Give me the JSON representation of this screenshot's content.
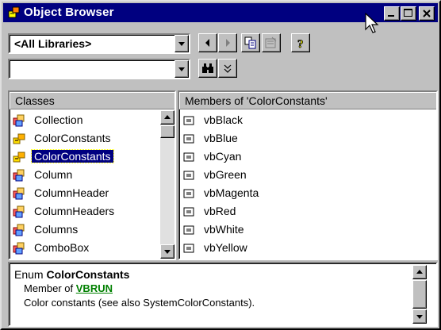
{
  "window": {
    "title": "Object Browser"
  },
  "library_combo": {
    "value": "<All Libraries>"
  },
  "search_combo": {
    "value": ""
  },
  "classes": {
    "header": "Classes",
    "items": [
      {
        "label": "Collection",
        "icon": "class-icon"
      },
      {
        "label": "ColorConstants",
        "icon": "enum-icon"
      },
      {
        "label": "ColorConstants",
        "icon": "enum-icon",
        "selected": true
      },
      {
        "label": "Column",
        "icon": "class-icon"
      },
      {
        "label": "ColumnHeader",
        "icon": "class-icon"
      },
      {
        "label": "ColumnHeaders",
        "icon": "class-icon"
      },
      {
        "label": "Columns",
        "icon": "class-icon"
      },
      {
        "label": "ComboBox",
        "icon": "class-icon"
      }
    ]
  },
  "members": {
    "header": "Members of 'ColorConstants'",
    "items": [
      {
        "label": "vbBlack",
        "icon": "constant-icon"
      },
      {
        "label": "vbBlue",
        "icon": "constant-icon"
      },
      {
        "label": "vbCyan",
        "icon": "constant-icon"
      },
      {
        "label": "vbGreen",
        "icon": "constant-icon"
      },
      {
        "label": "vbMagenta",
        "icon": "constant-icon"
      },
      {
        "label": "vbRed",
        "icon": "constant-icon"
      },
      {
        "label": "vbWhite",
        "icon": "constant-icon"
      },
      {
        "label": "vbYellow",
        "icon": "constant-icon"
      }
    ]
  },
  "details": {
    "kind": "Enum",
    "name": "ColorConstants",
    "member_of_prefix": "Member of",
    "member_of_link": "VBRUN",
    "description": "Color constants (see also SystemColorConstants)."
  },
  "colors": {
    "titlebar": "#000080",
    "selection": "#000080",
    "link": "#008000",
    "face": "#c0c0c0"
  }
}
